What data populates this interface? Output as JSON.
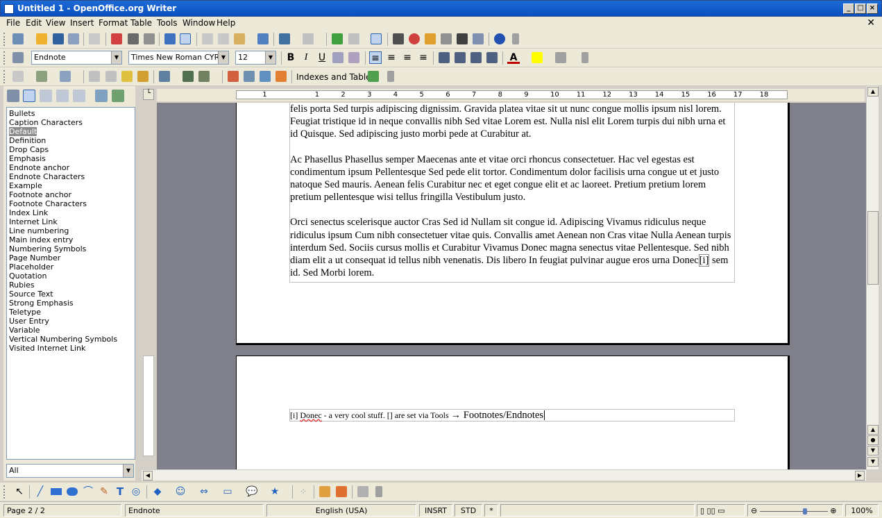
{
  "window": {
    "title": "Untitled 1 - OpenOffice.org Writer"
  },
  "menu": [
    {
      "label": "File",
      "key": "F"
    },
    {
      "label": "Edit",
      "key": "E"
    },
    {
      "label": "View",
      "key": "V"
    },
    {
      "label": "Insert",
      "key": "I"
    },
    {
      "label": "Format",
      "key": "o"
    },
    {
      "label": "Table",
      "key": "a"
    },
    {
      "label": "Tools",
      "key": "T"
    },
    {
      "label": "Window",
      "key": "W"
    },
    {
      "label": "Help",
      "key": "H"
    }
  ],
  "formatting": {
    "paragraph_style": "Endnote",
    "font_name": "Times New Roman CYR",
    "font_size": "12"
  },
  "toolbar3": {
    "indexes_label": "Indexes and Tables"
  },
  "stylist": {
    "items": [
      "Bullets",
      "Caption Characters",
      "Default",
      "Definition",
      "Drop Caps",
      "Emphasis",
      "Endnote anchor",
      "Endnote Characters",
      "Example",
      "Footnote anchor",
      "Footnote Characters",
      "Index Link",
      "Internet Link",
      "Line numbering",
      "Main index entry",
      "Numbering Symbols",
      "Page Number",
      "Placeholder",
      "Quotation",
      "Rubies",
      "Source Text",
      "Strong Emphasis",
      "Teletype",
      "User Entry",
      "Variable",
      "Vertical Numbering Symbols",
      "Visited Internet Link"
    ],
    "selected": "Default",
    "filter": "All"
  },
  "ruler": {
    "numbers": [
      "1",
      "1",
      "2",
      "3",
      "4",
      "5",
      "6",
      "7",
      "8",
      "9",
      "10",
      "11",
      "12",
      "13",
      "14",
      "15",
      "16",
      "17",
      "18"
    ]
  },
  "document": {
    "paragraphs": [
      "felis porta Sed turpis adipiscing dignissim. Gravida platea vitae sit ut nunc congue mollis ipsum nisl lorem. Feugiat tristique id in neque convallis nibh Sed vitae Lorem est. Nulla nisl elit Lorem turpis dui nibh urna et id Quisque. Sed adipiscing justo morbi pede at Curabitur at.",
      "Ac Phasellus Phasellus semper Maecenas ante et vitae orci rhoncus consectetuer. Hac vel egestas est condimentum ipsum Pellentesque Sed pede elit tortor. Condimentum dolor facilisis urna congue ut et justo natoque Sed mauris. Aenean felis Curabitur nec et eget congue elit et ac laoreet. Pretium pretium lorem pretium pellentesque wisi tellus fringilla Vestibulum justo.",
      "Orci senectus scelerisque auctor Cras Sed id Nullam sit congue id. Adipiscing Vivamus ridiculus neque ridiculus ipsum Cum nibh consectetuer vitae quis. Convallis amet Aenean non Cras vitae Nulla Aenean turpis interdum Sed. Sociis cursus mollis et Curabitur Vivamus Donec magna senectus vitae Pellentesque. Sed nibh diam elit a ut consequat id tellus nibh venenatis. Dis libero In feugiat pulvinar augue eros urna Donec"
    ],
    "endnote_anchor": "[i]",
    "last_tail": " sem id. Sed Morbi lorem.",
    "endnote": {
      "marker": "[i]",
      "word": "Donec",
      "text": " - a very cool stuff. [] are set via Tools ",
      "arrow": "→",
      "tail": " Footnotes/Endnotes"
    }
  },
  "statusbar": {
    "page": "Page 2 / 2",
    "style": "Endnote",
    "language": "English (USA)",
    "insert_mode": "INSRT",
    "selection_mode": "STD",
    "modified": "*",
    "zoom": "100%"
  },
  "colors": {
    "titlebar": "#0a4fbf",
    "font_color_bar": "#c00000",
    "highlight_bar": "#ffff00"
  }
}
